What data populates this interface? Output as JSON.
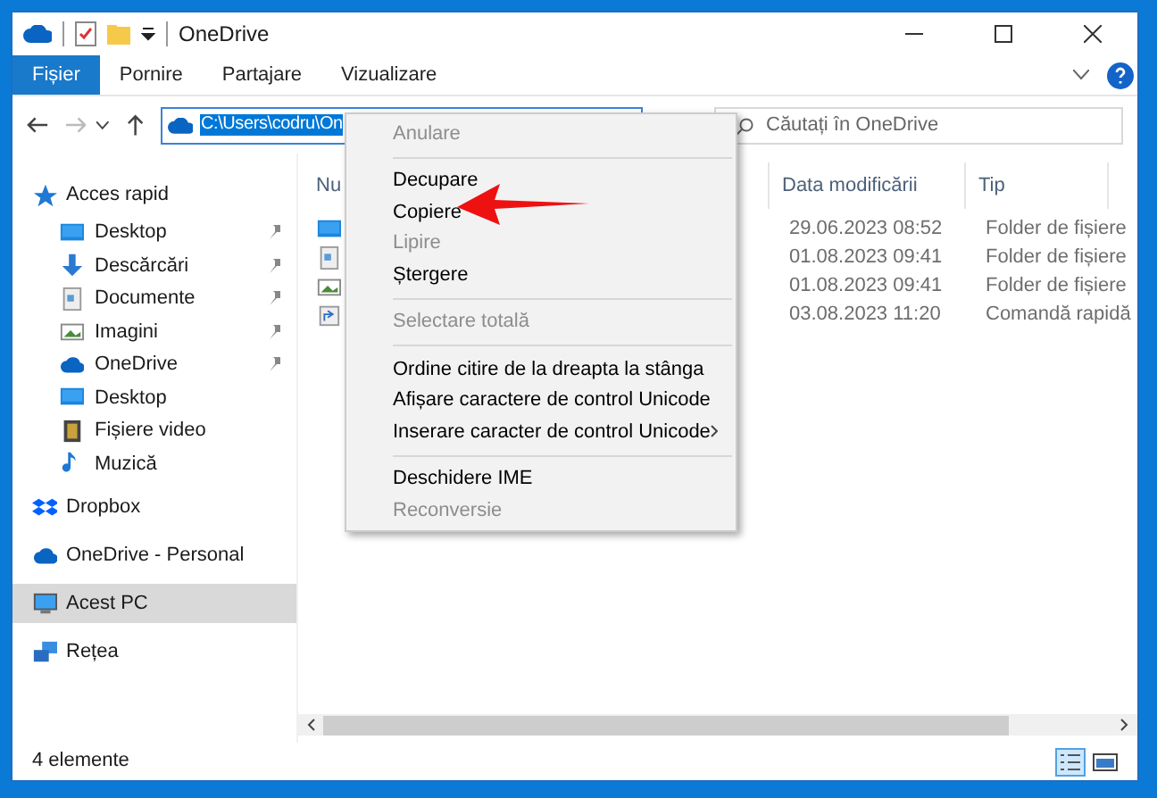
{
  "window": {
    "title": "OneDrive"
  },
  "ribbon_tabs": [
    {
      "label": "Fișier",
      "selected": true
    },
    {
      "label": "Pornire",
      "selected": false
    },
    {
      "label": "Partajare",
      "selected": false
    },
    {
      "label": "Vizualizare",
      "selected": false
    }
  ],
  "address_bar": {
    "value": "C:\\Users\\codru\\On",
    "selected": true
  },
  "search": {
    "placeholder": "Căutați în OneDrive"
  },
  "sidebar": {
    "items": [
      {
        "label": "Acces rapid",
        "kind": "star",
        "selected": false,
        "children": [
          {
            "label": "Desktop",
            "kind": "desktop",
            "pinned": true
          },
          {
            "label": "Descărcări",
            "kind": "download",
            "pinned": true
          },
          {
            "label": "Documente",
            "kind": "document",
            "pinned": true
          },
          {
            "label": "Imagini",
            "kind": "image",
            "pinned": true
          },
          {
            "label": "OneDrive",
            "kind": "cloud",
            "pinned": true
          },
          {
            "label": "Desktop",
            "kind": "desktop",
            "pinned": false
          },
          {
            "label": "Fișiere video",
            "kind": "film",
            "pinned": false
          },
          {
            "label": "Muzică",
            "kind": "music",
            "pinned": false
          }
        ]
      },
      {
        "label": "Dropbox",
        "kind": "dropbox",
        "selected": false
      },
      {
        "label": "OneDrive - Personal",
        "kind": "cloud",
        "selected": false
      },
      {
        "label": "Acest PC",
        "kind": "pc",
        "selected": true
      },
      {
        "label": "Rețea",
        "kind": "network",
        "selected": false
      }
    ]
  },
  "file_list": {
    "columns": [
      "Nu",
      "Data modificării",
      "Tip"
    ],
    "rows": [
      {
        "kind": "desktop",
        "date": "29.06.2023 08:52",
        "type": "Folder de fișiere"
      },
      {
        "kind": "document",
        "date": "01.08.2023 09:41",
        "type": "Folder de fișiere"
      },
      {
        "kind": "image",
        "date": "01.08.2023 09:41",
        "type": "Folder de fișiere"
      },
      {
        "kind": "shortcut",
        "date": "03.08.2023 11:20",
        "type": "Comandă rapidă"
      }
    ]
  },
  "context_menu": [
    {
      "kind": "item",
      "label": "Anulare",
      "disabled": true
    },
    {
      "kind": "separator"
    },
    {
      "kind": "item",
      "label": "Decupare",
      "disabled": false
    },
    {
      "kind": "item",
      "label": "Copiere",
      "disabled": false
    },
    {
      "kind": "item",
      "label": "Lipire",
      "disabled": true
    },
    {
      "kind": "item",
      "label": "Ștergere",
      "disabled": false
    },
    {
      "kind": "separator"
    },
    {
      "kind": "item",
      "label": "Selectare totală",
      "disabled": true
    },
    {
      "kind": "separator"
    },
    {
      "kind": "item",
      "label": "Ordine citire de la dreapta la stânga",
      "disabled": false
    },
    {
      "kind": "item",
      "label": "Afișare caractere de control Unicode",
      "disabled": false
    },
    {
      "kind": "item",
      "label": "Inserare caracter de control Unicode",
      "disabled": false,
      "submenu": true
    },
    {
      "kind": "separator"
    },
    {
      "kind": "item",
      "label": "Deschidere IME",
      "disabled": false
    },
    {
      "kind": "item",
      "label": "Reconversie",
      "disabled": true
    }
  ],
  "status_bar": {
    "text": "4 elemente"
  }
}
